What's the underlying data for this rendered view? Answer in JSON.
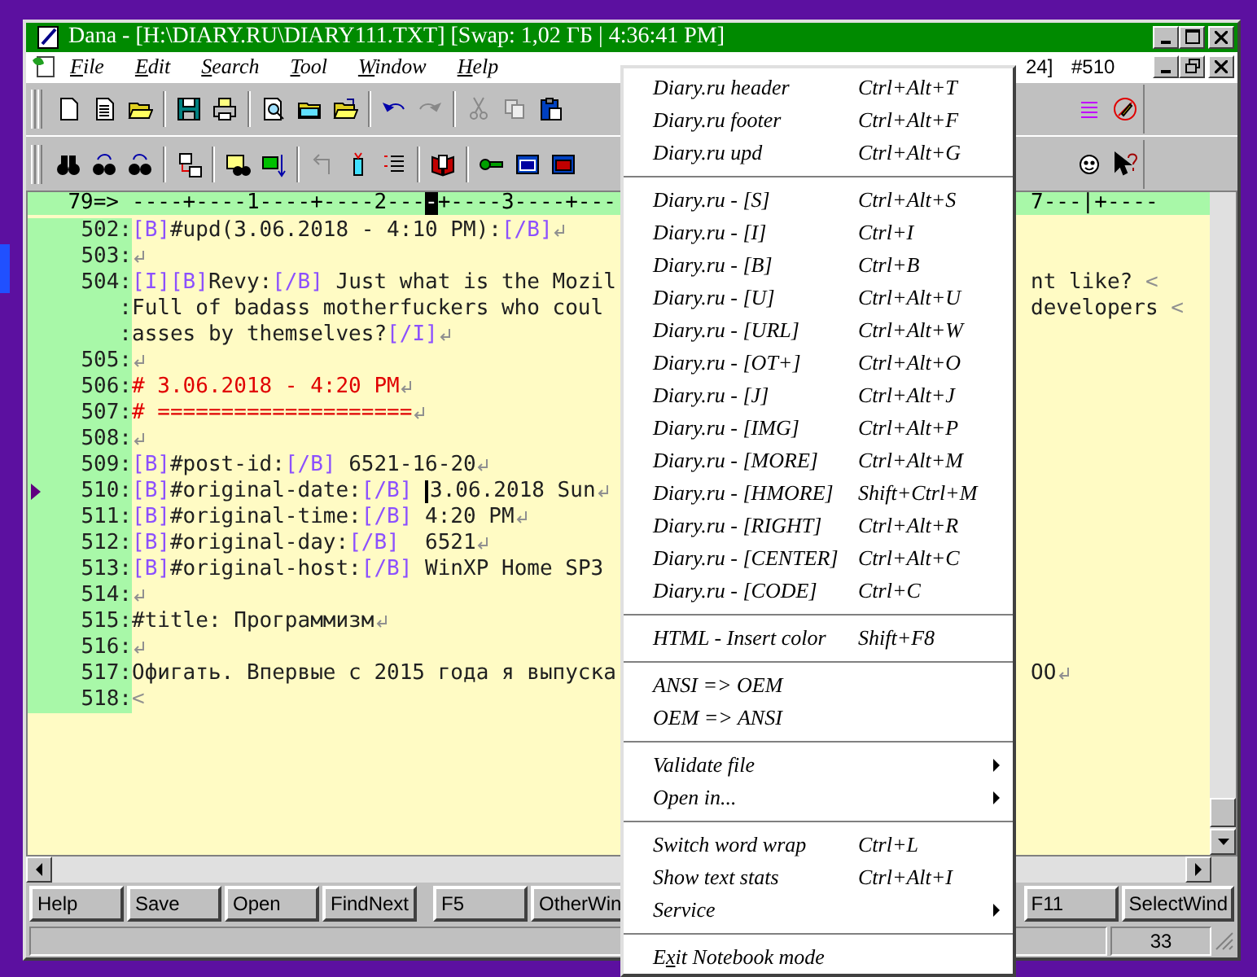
{
  "window": {
    "title": "Dana - [H:\\DIARY.RU\\DIARY111.TXT] [Swap: 1,02 ГБ | 4:36:41 PM]"
  },
  "menu_bar": [
    {
      "accel": "F",
      "rest": "ile"
    },
    {
      "accel": "E",
      "rest": "dit"
    },
    {
      "accel": "S",
      "rest": "earch"
    },
    {
      "accel": "T",
      "rest": "ool"
    },
    {
      "accel": "W",
      "rest": "indow"
    },
    {
      "accel": "H",
      "rest": "elp"
    }
  ],
  "position_info": [
    "24]",
    "#510"
  ],
  "ruler": {
    "label": "79=>",
    "before": "----+----1----+----2---",
    "cursor": "-",
    "after": "+----3----+---",
    "right": "7---|+----"
  },
  "lines": [
    {
      "num": "502:",
      "current": false,
      "eol": true,
      "segs": [
        {
          "kind": "tag",
          "text": "[B]"
        },
        {
          "kind": "text",
          "text": "#upd(3.06.2018 - 4:10 PM):"
        },
        {
          "kind": "tag",
          "text": "[/B]"
        }
      ]
    },
    {
      "num": "503:",
      "current": false,
      "eol": true
    },
    {
      "num": "504:",
      "current": false,
      "eol": false,
      "segs": [
        {
          "kind": "tag",
          "text": "[I]"
        },
        {
          "kind": "tag",
          "text": "[B]"
        },
        {
          "kind": "text",
          "text": "Revy:"
        },
        {
          "kind": "tag",
          "text": "[/B]"
        },
        {
          "kind": "text",
          "text": " Just what is the Mozil"
        }
      ],
      "right": [
        {
          "kind": "text",
          "text": "nt like? "
        },
        {
          "kind": "mark",
          "text": "<"
        }
      ]
    },
    {
      "num": ":",
      "current": false,
      "eol": false,
      "segs": [
        {
          "kind": "text",
          "text": "Full of badass motherfuckers who coul"
        }
      ],
      "right": [
        {
          "kind": "text",
          "text": "developers "
        },
        {
          "kind": "mark",
          "text": "<"
        }
      ]
    },
    {
      "num": ":",
      "current": false,
      "eol": true,
      "segs": [
        {
          "kind": "text",
          "text": "asses by themselves?"
        },
        {
          "kind": "tag",
          "text": "[/I]"
        }
      ]
    },
    {
      "num": "505:",
      "current": false,
      "eol": true
    },
    {
      "num": "506:",
      "current": false,
      "eol": true,
      "segs": [
        {
          "kind": "red",
          "text": "# 3.06.2018 - 4:20 PM"
        }
      ]
    },
    {
      "num": "507:",
      "current": false,
      "eol": true,
      "segs": [
        {
          "kind": "red",
          "text": "# ===================="
        }
      ]
    },
    {
      "num": "508:",
      "current": false,
      "eol": true
    },
    {
      "num": "509:",
      "current": false,
      "eol": true,
      "segs": [
        {
          "kind": "tag",
          "text": "[B]"
        },
        {
          "kind": "text",
          "text": "#post-id:"
        },
        {
          "kind": "tag",
          "text": "[/B]"
        },
        {
          "kind": "text",
          "text": " 6521-16-20"
        }
      ]
    },
    {
      "num": "510:",
      "current": true,
      "eol": true,
      "segs": [
        {
          "kind": "tag",
          "text": "[B]"
        },
        {
          "kind": "text",
          "text": "#original-date:"
        },
        {
          "kind": "tag",
          "text": "[/B] "
        },
        {
          "kind": "text",
          "text": "3.06.2018 Sun",
          "caret": true
        }
      ]
    },
    {
      "num": "511:",
      "current": false,
      "eol": true,
      "segs": [
        {
          "kind": "tag",
          "text": "[B]"
        },
        {
          "kind": "text",
          "text": "#original-time:"
        },
        {
          "kind": "tag",
          "text": "[/B]"
        },
        {
          "kind": "text",
          "text": " 4:20 PM"
        }
      ]
    },
    {
      "num": "512:",
      "current": false,
      "eol": true,
      "segs": [
        {
          "kind": "tag",
          "text": "[B]"
        },
        {
          "kind": "text",
          "text": "#original-day:"
        },
        {
          "kind": "tag",
          "text": "[/B]"
        },
        {
          "kind": "text",
          "text": "  6521"
        }
      ]
    },
    {
      "num": "513:",
      "current": false,
      "eol": false,
      "segs": [
        {
          "kind": "tag",
          "text": "[B]"
        },
        {
          "kind": "text",
          "text": "#original-host:"
        },
        {
          "kind": "tag",
          "text": "[/B]"
        },
        {
          "kind": "text",
          "text": " WinXP Home SP3"
        }
      ]
    },
    {
      "num": "514:",
      "current": false,
      "eol": true
    },
    {
      "num": "515:",
      "current": false,
      "eol": true,
      "segs": [
        {
          "kind": "text",
          "text": "#title: Программизм"
        }
      ]
    },
    {
      "num": "516:",
      "current": false,
      "eol": true
    },
    {
      "num": "517:",
      "current": false,
      "eol": true,
      "segs": [
        {
          "kind": "text",
          "text": "Офигать. Впервые с 2015 года я выпуска"
        }
      ],
      "right": [
        {
          "kind": "text",
          "text": "OO"
        }
      ]
    },
    {
      "num": "518:",
      "current": false,
      "eol": false,
      "segs": [
        {
          "kind": "mark",
          "text": "<"
        }
      ]
    }
  ],
  "function_key_groups": [
    [
      "Help",
      "Save",
      "Open",
      "FindNext"
    ],
    [
      "F5",
      "OtherWin"
    ],
    [
      "F11",
      "SelectWind"
    ]
  ],
  "status_bar": [
    "33"
  ],
  "context_menu": [
    {
      "kind": "item",
      "label": "Diary.ru header",
      "shortcut": "Ctrl+Alt+T"
    },
    {
      "kind": "item",
      "label": "Diary.ru footer",
      "shortcut": "Ctrl+Alt+F"
    },
    {
      "kind": "item",
      "label": "Diary.ru upd",
      "shortcut": "Ctrl+Alt+G"
    },
    {
      "kind": "separator"
    },
    {
      "kind": "item",
      "label": "Diary.ru - [S]",
      "shortcut": "Ctrl+Alt+S"
    },
    {
      "kind": "item",
      "label": "Diary.ru - [I]",
      "shortcut": "Ctrl+I"
    },
    {
      "kind": "item",
      "label": "Diary.ru - [B]",
      "shortcut": "Ctrl+B"
    },
    {
      "kind": "item",
      "label": "Diary.ru - [U]",
      "shortcut": "Ctrl+Alt+U"
    },
    {
      "kind": "item",
      "label": "Diary.ru - [URL]",
      "shortcut": "Ctrl+Alt+W"
    },
    {
      "kind": "item",
      "label": "Diary.ru - [OT+]",
      "shortcut": "Ctrl+Alt+O"
    },
    {
      "kind": "item",
      "label": "Diary.ru - [J]",
      "shortcut": "Ctrl+Alt+J"
    },
    {
      "kind": "item",
      "label": "Diary.ru - [IMG]",
      "shortcut": "Ctrl+Alt+P"
    },
    {
      "kind": "item",
      "label": "Diary.ru - [MORE]",
      "shortcut": "Ctrl+Alt+M"
    },
    {
      "kind": "item",
      "label": "Diary.ru - [HMORE]",
      "shortcut": "Shift+Ctrl+M"
    },
    {
      "kind": "item",
      "label": "Diary.ru - [RIGHT]",
      "shortcut": "Ctrl+Alt+R"
    },
    {
      "kind": "item",
      "label": "Diary.ru - [CENTER]",
      "shortcut": "Ctrl+Alt+C"
    },
    {
      "kind": "item",
      "label": "Diary.ru - [CODE]",
      "shortcut": "Ctrl+C"
    },
    {
      "kind": "separator"
    },
    {
      "kind": "item",
      "label": "HTML - Insert color",
      "shortcut": "Shift+F8"
    },
    {
      "kind": "separator"
    },
    {
      "kind": "item",
      "label": "ANSI => OEM"
    },
    {
      "kind": "item",
      "label": "OEM => ANSI"
    },
    {
      "kind": "separator"
    },
    {
      "kind": "item",
      "label": "Validate file",
      "submenu": true
    },
    {
      "kind": "item",
      "label": "Open in...",
      "submenu": true
    },
    {
      "kind": "separator"
    },
    {
      "kind": "item",
      "label": "Switch word wrap",
      "shortcut": "Ctrl+L"
    },
    {
      "kind": "item",
      "label": "Show text stats",
      "shortcut": "Ctrl+Alt+I"
    },
    {
      "kind": "item",
      "label": "Service",
      "submenu": true
    },
    {
      "kind": "separator"
    },
    {
      "kind": "item",
      "label": "E",
      "accel": "x",
      "rest": "it Notebook mode"
    }
  ]
}
